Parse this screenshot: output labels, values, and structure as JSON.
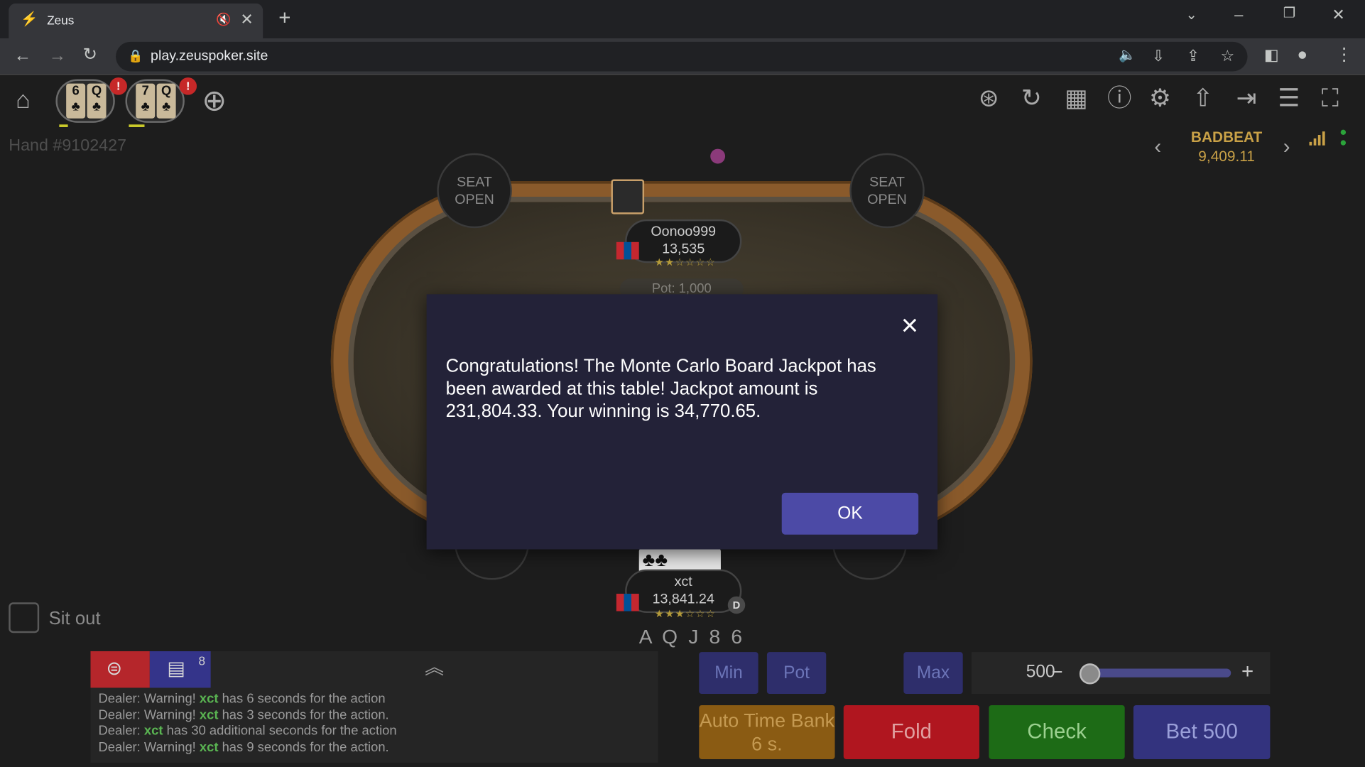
{
  "browser": {
    "tab_title": "Zeus",
    "url": "play.zeuspoker.site"
  },
  "app": {
    "hand_label": "Hand #9102427",
    "table_tabs": [
      {
        "ranks": [
          "6",
          "Q"
        ],
        "badge": "!"
      },
      {
        "ranks": [
          "7",
          "Q"
        ],
        "badge": "!"
      }
    ],
    "badbeat": {
      "label": "BADBEAT",
      "amount": "9,409.11"
    }
  },
  "table": {
    "seat_open": "SEAT\nOPEN",
    "seat_open_partial": "OPEN",
    "top_player": {
      "name": "Oonoo999",
      "stack": "13,535"
    },
    "pot_label": "Pot: 1,000",
    "hero": {
      "name": "xct",
      "stack": "13,841.24",
      "dealer": "D"
    },
    "board": "A Q J 8 6"
  },
  "modal": {
    "message": "Congratulations! The Monte Carlo Board Jackpot has been awarded at this table! Jackpot amount is 231,804.33. Your winning is 34,770.65.",
    "ok_label": "OK"
  },
  "controls": {
    "sit_out": "Sit out",
    "chat_count": "8",
    "chat_lines": [
      {
        "pre": "Dealer: Warning! ",
        "name": "xct",
        "post": " has 6 seconds for the action"
      },
      {
        "pre": "Dealer: Warning! ",
        "name": "xct",
        "post": " has 3 seconds for the action."
      },
      {
        "pre": "Dealer: ",
        "name": "xct",
        "post": " has 30 additional seconds for the action"
      },
      {
        "pre": "Dealer: Warning! ",
        "name": "xct",
        "post": " has 9 seconds for the action."
      }
    ],
    "min_label": "Min",
    "pot_label": "Pot",
    "max_label": "Max",
    "bet_amount": "500",
    "auto_timebank": "Auto Time Bank 6 s.",
    "fold_label": "Fold",
    "check_label": "Check",
    "bet_label": "Bet 500"
  },
  "colors": {
    "fold": "#b0161f",
    "check": "#1d6b16",
    "bet": "#33337e",
    "timebank": "#8a5b13",
    "badbeat": "#c9a147"
  }
}
